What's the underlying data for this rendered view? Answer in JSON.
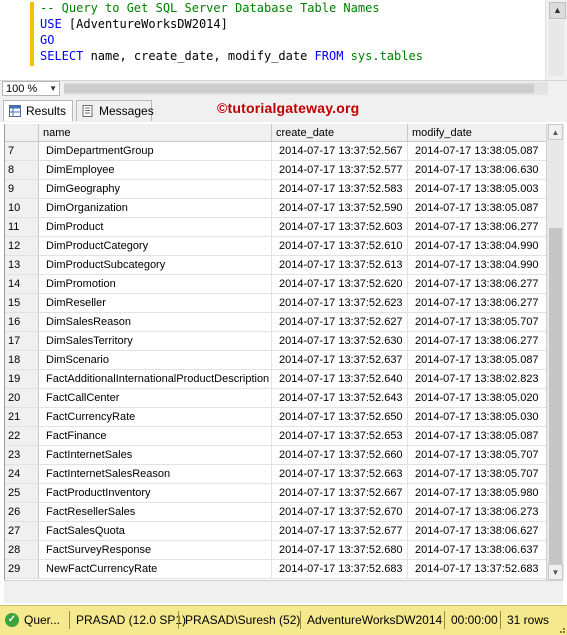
{
  "editor": {
    "lines": [
      {
        "parts": [
          {
            "t": "-- Query to Get SQL Server Database Table Names",
            "c": "cm"
          }
        ]
      },
      {
        "parts": [
          {
            "t": "USE ",
            "c": "kw"
          },
          {
            "t": "[AdventureWorksDW2014]",
            "c": "tx"
          }
        ]
      },
      {
        "parts": [
          {
            "t": "GO",
            "c": "kw"
          }
        ]
      },
      {
        "parts": [
          {
            "t": "SELECT ",
            "c": "kw"
          },
          {
            "t": "name, create_date, modify_date ",
            "c": "tx"
          },
          {
            "t": "FROM ",
            "c": "kw"
          },
          {
            "t": "sys.tables",
            "c": "sys"
          }
        ]
      }
    ]
  },
  "zoom": {
    "value": "100 %"
  },
  "tabs": {
    "results": "Results",
    "messages": "Messages"
  },
  "watermark": "©tutorialgateway.org",
  "grid": {
    "columns": [
      "name",
      "create_date",
      "modify_date"
    ],
    "rows": [
      [
        "7",
        "DimDepartmentGroup",
        "2014-07-17 13:37:52.567",
        "2014-07-17 13:38:05.087"
      ],
      [
        "8",
        "DimEmployee",
        "2014-07-17 13:37:52.577",
        "2014-07-17 13:38:06.630"
      ],
      [
        "9",
        "DimGeography",
        "2014-07-17 13:37:52.583",
        "2014-07-17 13:38:05.003"
      ],
      [
        "10",
        "DimOrganization",
        "2014-07-17 13:37:52.590",
        "2014-07-17 13:38:05.087"
      ],
      [
        "11",
        "DimProduct",
        "2014-07-17 13:37:52.603",
        "2014-07-17 13:38:06.277"
      ],
      [
        "12",
        "DimProductCategory",
        "2014-07-17 13:37:52.610",
        "2014-07-17 13:38:04.990"
      ],
      [
        "13",
        "DimProductSubcategory",
        "2014-07-17 13:37:52.613",
        "2014-07-17 13:38:04.990"
      ],
      [
        "14",
        "DimPromotion",
        "2014-07-17 13:37:52.620",
        "2014-07-17 13:38:06.277"
      ],
      [
        "15",
        "DimReseller",
        "2014-07-17 13:37:52.623",
        "2014-07-17 13:38:06.277"
      ],
      [
        "16",
        "DimSalesReason",
        "2014-07-17 13:37:52.627",
        "2014-07-17 13:38:05.707"
      ],
      [
        "17",
        "DimSalesTerritory",
        "2014-07-17 13:37:52.630",
        "2014-07-17 13:38:06.277"
      ],
      [
        "18",
        "DimScenario",
        "2014-07-17 13:37:52.637",
        "2014-07-17 13:38:05.087"
      ],
      [
        "19",
        "FactAdditionalInternationalProductDescription",
        "2014-07-17 13:37:52.640",
        "2014-07-17 13:38:02.823"
      ],
      [
        "20",
        "FactCallCenter",
        "2014-07-17 13:37:52.643",
        "2014-07-17 13:38:05.020"
      ],
      [
        "21",
        "FactCurrencyRate",
        "2014-07-17 13:37:52.650",
        "2014-07-17 13:38:05.030"
      ],
      [
        "22",
        "FactFinance",
        "2014-07-17 13:37:52.653",
        "2014-07-17 13:38:05.087"
      ],
      [
        "23",
        "FactInternetSales",
        "2014-07-17 13:37:52.660",
        "2014-07-17 13:38:05.707"
      ],
      [
        "24",
        "FactInternetSalesReason",
        "2014-07-17 13:37:52.663",
        "2014-07-17 13:38:05.707"
      ],
      [
        "25",
        "FactProductInventory",
        "2014-07-17 13:37:52.667",
        "2014-07-17 13:38:05.980"
      ],
      [
        "26",
        "FactResellerSales",
        "2014-07-17 13:37:52.670",
        "2014-07-17 13:38:06.273"
      ],
      [
        "27",
        "FactSalesQuota",
        "2014-07-17 13:37:52.677",
        "2014-07-17 13:38:06.627"
      ],
      [
        "28",
        "FactSurveyResponse",
        "2014-07-17 13:37:52.680",
        "2014-07-17 13:38:06.637"
      ],
      [
        "29",
        "NewFactCurrencyRate",
        "2014-07-17 13:37:52.683",
        "2014-07-17 13:37:52.683"
      ]
    ]
  },
  "status": {
    "query": "Quer...",
    "server": "PRASAD (12.0 SP1)",
    "user": "PRASAD\\Suresh (52)",
    "database": "AdventureWorksDW2014",
    "time": "00:00:00",
    "rows": "31 rows"
  },
  "colors": {
    "status_bar": "#f5e98f",
    "accent_gutter": "#f3c300",
    "watermark": "#c00000"
  }
}
